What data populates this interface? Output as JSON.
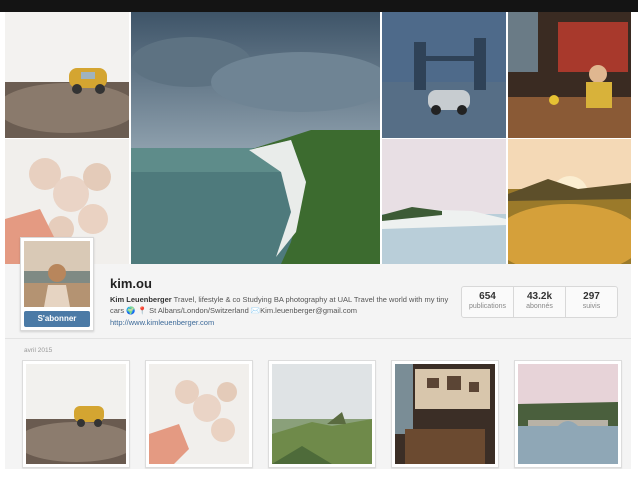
{
  "profile": {
    "username": "kim.ou",
    "follow_label": "S'abonner",
    "full_name": "Kim Leuenberger",
    "bio": "Travel, lifestyle & co Studying BA photography at UAL Travel the world with my tiny cars 🌍 📍 St Albans/London/Switzerland ✉️Kim.leuenberger@gmail.com",
    "website": "http://www.kimleuenberger.com"
  },
  "stats": [
    {
      "value": "654",
      "label": "publications"
    },
    {
      "value": "43.2k",
      "label": "abonnés"
    },
    {
      "value": "297",
      "label": "suivis"
    }
  ],
  "feed": {
    "month_label": "avril 2015"
  },
  "colors": {
    "follow_button": "#4b7aa6",
    "link": "#3d6a99",
    "top_bar": "#141414"
  }
}
